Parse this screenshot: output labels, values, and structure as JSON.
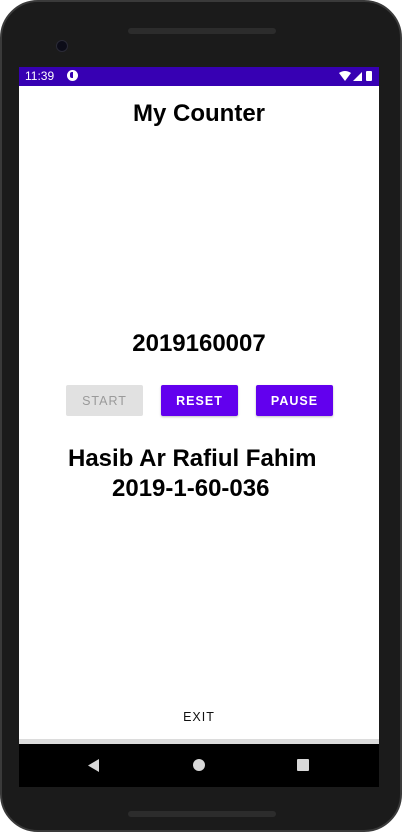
{
  "status_bar": {
    "time": "11:39",
    "app_icon": "app-notification-icon",
    "wifi_icon": "wifi-icon",
    "signal_icon": "signal-icon",
    "battery_icon": "battery-icon",
    "background_color": "#3700b3"
  },
  "app": {
    "title": "My Counter",
    "counter_value": "2019160007"
  },
  "buttons": {
    "start_label": "START",
    "reset_label": "RESET",
    "pause_label": "PAUSE",
    "exit_label": "EXIT",
    "accent_color": "#6200ee",
    "disabled_color": "#e1e1e1"
  },
  "info": {
    "name": "Hasib Ar Rafiul Fahim",
    "student_id": "2019-1-60-036"
  },
  "navigation": {
    "back_icon": "back-triangle-icon",
    "home_icon": "home-circle-icon",
    "recents_icon": "recents-square-icon"
  }
}
